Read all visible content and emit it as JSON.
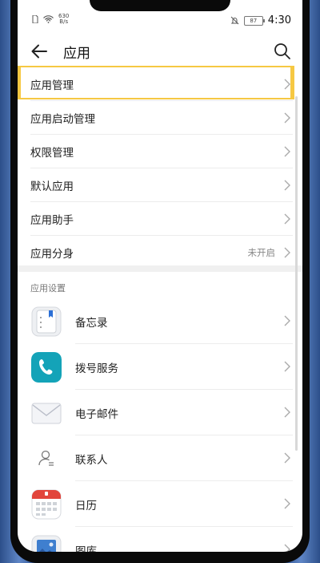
{
  "status": {
    "speed_top": "630",
    "speed_bottom": "B/s",
    "battery": "87",
    "time": "4:30"
  },
  "appbar": {
    "title": "应用"
  },
  "menu": [
    {
      "label": "应用管理",
      "value": ""
    },
    {
      "label": "应用启动管理",
      "value": ""
    },
    {
      "label": "权限管理",
      "value": ""
    },
    {
      "label": "默认应用",
      "value": ""
    },
    {
      "label": "应用助手",
      "value": ""
    },
    {
      "label": "应用分身",
      "value": "未开启"
    }
  ],
  "section_title": "应用设置",
  "apps": [
    {
      "label": "备忘录",
      "icon": "memo-icon"
    },
    {
      "label": "拨号服务",
      "icon": "phone-icon"
    },
    {
      "label": "电子邮件",
      "icon": "mail-icon"
    },
    {
      "label": "联系人",
      "icon": "contacts-icon"
    },
    {
      "label": "日历",
      "icon": "calendar-icon"
    },
    {
      "label": "图库",
      "icon": "gallery-icon"
    }
  ],
  "colors": {
    "highlight": "#f6c843",
    "phone_teal": "#14a3b8",
    "calendar_red": "#e2453c"
  }
}
